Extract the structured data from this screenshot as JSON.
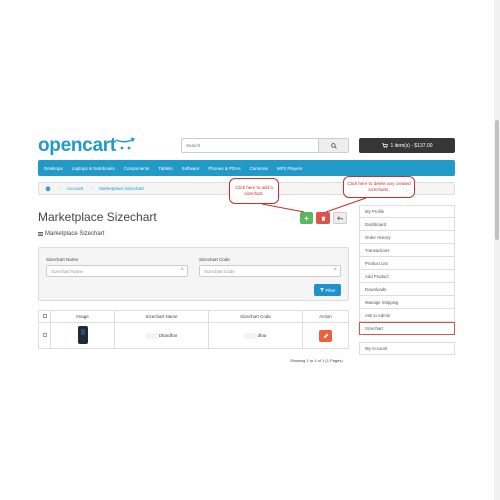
{
  "logo": {
    "text": "opencart"
  },
  "header": {
    "search_placeholder": "Search",
    "cart_label": "1 item(s) - $137.00"
  },
  "menu": {
    "items": [
      "Desktops",
      "Laptops & Notebooks",
      "Components",
      "Tablets",
      "Software",
      "Phones & PDAs",
      "Cameras",
      "MP3 Players"
    ]
  },
  "breadcrumb": {
    "items": [
      "Account",
      "Marketplace Sizechart"
    ]
  },
  "page": {
    "title": "Marketplace Sizechart",
    "subtitle": "Marketplace Sizechart"
  },
  "callouts": {
    "add": "Click here to add a sizechart.",
    "delete": "Click here to delete any created sizecharts."
  },
  "filter": {
    "name_label": "Sizechart Name",
    "name_placeholder": "Sizechart Name",
    "code_label": "Sizechart Code",
    "code_placeholder": "Sizechart Code",
    "button": "Filter"
  },
  "table": {
    "headers": [
      "Image",
      "Sizechart Name",
      "Sizechart Code",
      "Action"
    ],
    "rows": [
      {
        "name": "Dhardhar",
        "code": "dhar"
      }
    ]
  },
  "pagination": {
    "showing": "Showing 1 to 1 of 1 (1 Pages)"
  },
  "sidebar": {
    "items": [
      "My Profile",
      "Dashboard",
      "Order History",
      "Transactions",
      "Product List",
      "Add Product",
      "Downloads",
      "Manage Shipping",
      "Ask to Admin",
      "Sizechart"
    ],
    "items2": [
      "My Account"
    ],
    "highlighted": "Sizechart"
  },
  "colors": {
    "brand": "#229ac8",
    "add_button": "#5cb85c",
    "delete_button": "#d9534f",
    "callout_border": "#c9302c"
  }
}
